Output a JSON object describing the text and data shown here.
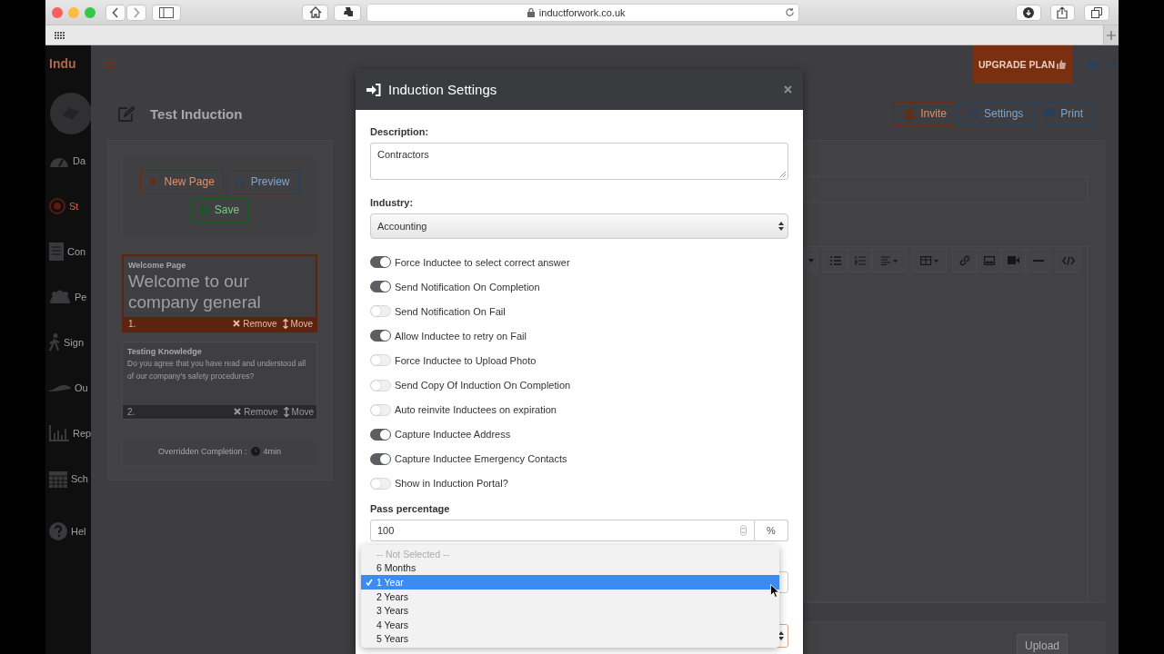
{
  "browser": {
    "url": "inductforwork.co.uk"
  },
  "app": {
    "logo_text": "Indu",
    "sidebar": {
      "items": [
        {
          "label": "Da",
          "selected": false
        },
        {
          "label": "St",
          "selected": true
        },
        {
          "label": "Con",
          "selected": false
        },
        {
          "label": "Pe",
          "selected": false
        },
        {
          "label": "Sign",
          "selected": false
        },
        {
          "label": "Ou",
          "selected": false
        },
        {
          "label": "Rep",
          "selected": false
        },
        {
          "label": "Sch",
          "selected": false
        },
        {
          "label": "Hel",
          "selected": false
        }
      ]
    },
    "upgrade_button": "UPGRADE PLAN",
    "page_title": "Test Induction",
    "header_buttons": [
      {
        "label": "Invite",
        "kind": "invite"
      },
      {
        "label": "Settings",
        "kind": "settings"
      },
      {
        "label": "Print",
        "kind": "print"
      }
    ],
    "action_buttons": [
      {
        "label": "New Page",
        "kind": "new"
      },
      {
        "label": "Preview",
        "kind": "preview"
      },
      {
        "label": "Save",
        "kind": "save"
      }
    ],
    "pages": [
      {
        "number": "1.",
        "title": "Welcome Page",
        "body": "Welcome to our company general",
        "kind": "heading",
        "selected": true,
        "remove": "Remove",
        "move": "Move"
      },
      {
        "number": "2.",
        "title": "Testing Knowledge",
        "body": "Do you agree that you have read and understood all of our company's safety procedures?",
        "kind": "question",
        "selected": false,
        "remove": "Remove",
        "move": "Move"
      }
    ],
    "completion": {
      "label": "Overridden Completion :",
      "value": "4min"
    },
    "upload_button": "Upload"
  },
  "modal": {
    "title": "Induction Settings",
    "description": {
      "label": "Description:",
      "value": "Contractors"
    },
    "industry": {
      "label": "Industry:",
      "value": "Accounting"
    },
    "toggles": [
      {
        "label": "Force Inductee to select correct answer",
        "on": true
      },
      {
        "label": "Send Notification On Completion",
        "on": true
      },
      {
        "label": "Send Notification On Fail",
        "on": false
      },
      {
        "label": "Allow Inductee to retry on Fail",
        "on": true
      },
      {
        "label": "Force Inductee to Upload Photo",
        "on": false
      },
      {
        "label": "Send Copy Of Induction On Completion",
        "on": false
      },
      {
        "label": "Auto reinvite Inductees on expiration",
        "on": false
      },
      {
        "label": "Capture Inductee Address",
        "on": true
      },
      {
        "label": "Capture Inductee Emergency Contacts",
        "on": true
      },
      {
        "label": "Show in Induction Portal?",
        "on": false
      }
    ],
    "pass_percentage": {
      "label": "Pass percentage",
      "value": "100",
      "unit": "%"
    },
    "dropdown": {
      "options": [
        {
          "label": "-- Not Selected --",
          "selected": false,
          "disabled": true
        },
        {
          "label": "6 Months",
          "selected": false,
          "disabled": false
        },
        {
          "label": "1 Year",
          "selected": true,
          "disabled": false
        },
        {
          "label": "2 Years",
          "selected": false,
          "disabled": false
        },
        {
          "label": "3 Years",
          "selected": false,
          "disabled": false
        },
        {
          "label": "4 Years",
          "selected": false,
          "disabled": false
        },
        {
          "label": "5 Years",
          "selected": false,
          "disabled": false
        }
      ]
    }
  }
}
